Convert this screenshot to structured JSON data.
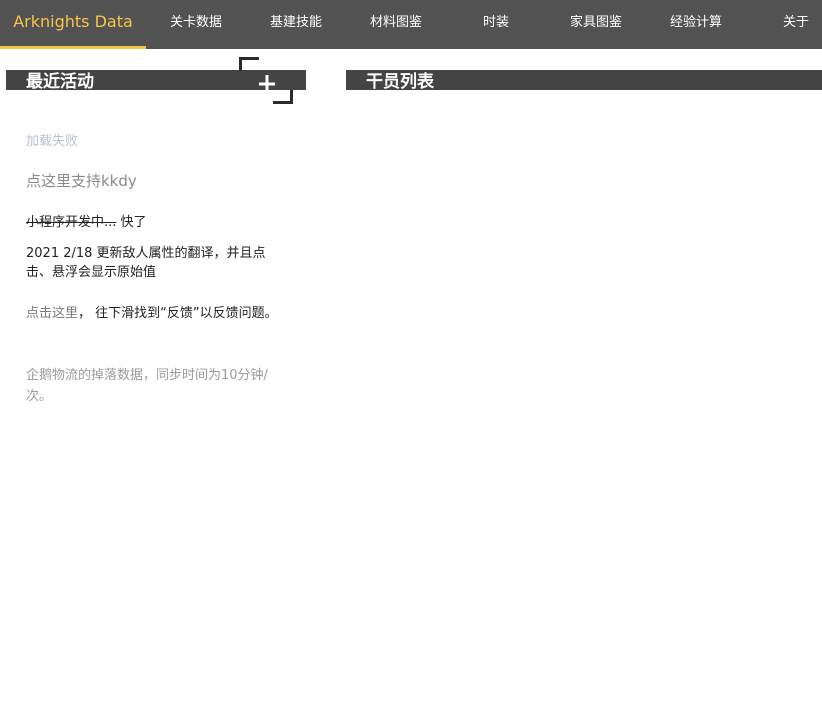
{
  "navbar": {
    "brand": "Arknights Data",
    "items": [
      {
        "label": "关卡数据"
      },
      {
        "label": "基建技能"
      },
      {
        "label": "材料图鉴"
      },
      {
        "label": "时装"
      },
      {
        "label": "家具图鉴"
      },
      {
        "label": "经验计算"
      },
      {
        "label": "关于"
      }
    ],
    "accent_color": "#f5c242"
  },
  "recent_activity": {
    "title": "最近活动",
    "load_failed": "加载失败",
    "support_link": "点这里支持kkdy",
    "dev_status_struck": "小程序开发中...",
    "dev_status_suffix": " 快了",
    "update_note": "2021 2/18 更新敌人属性的翻译，并且点击、悬浮会显示原始值",
    "feedback_link": "点击这里",
    "feedback_text": "， 往下滑找到“反馈”以反馈问题。",
    "penguin_note": "企鹅物流的掉落数据，同步时间为10分钟/次。"
  },
  "operator_list": {
    "title": "干员列表"
  },
  "icons": {
    "fullscreen": "fullscreen-bracket-icon"
  }
}
